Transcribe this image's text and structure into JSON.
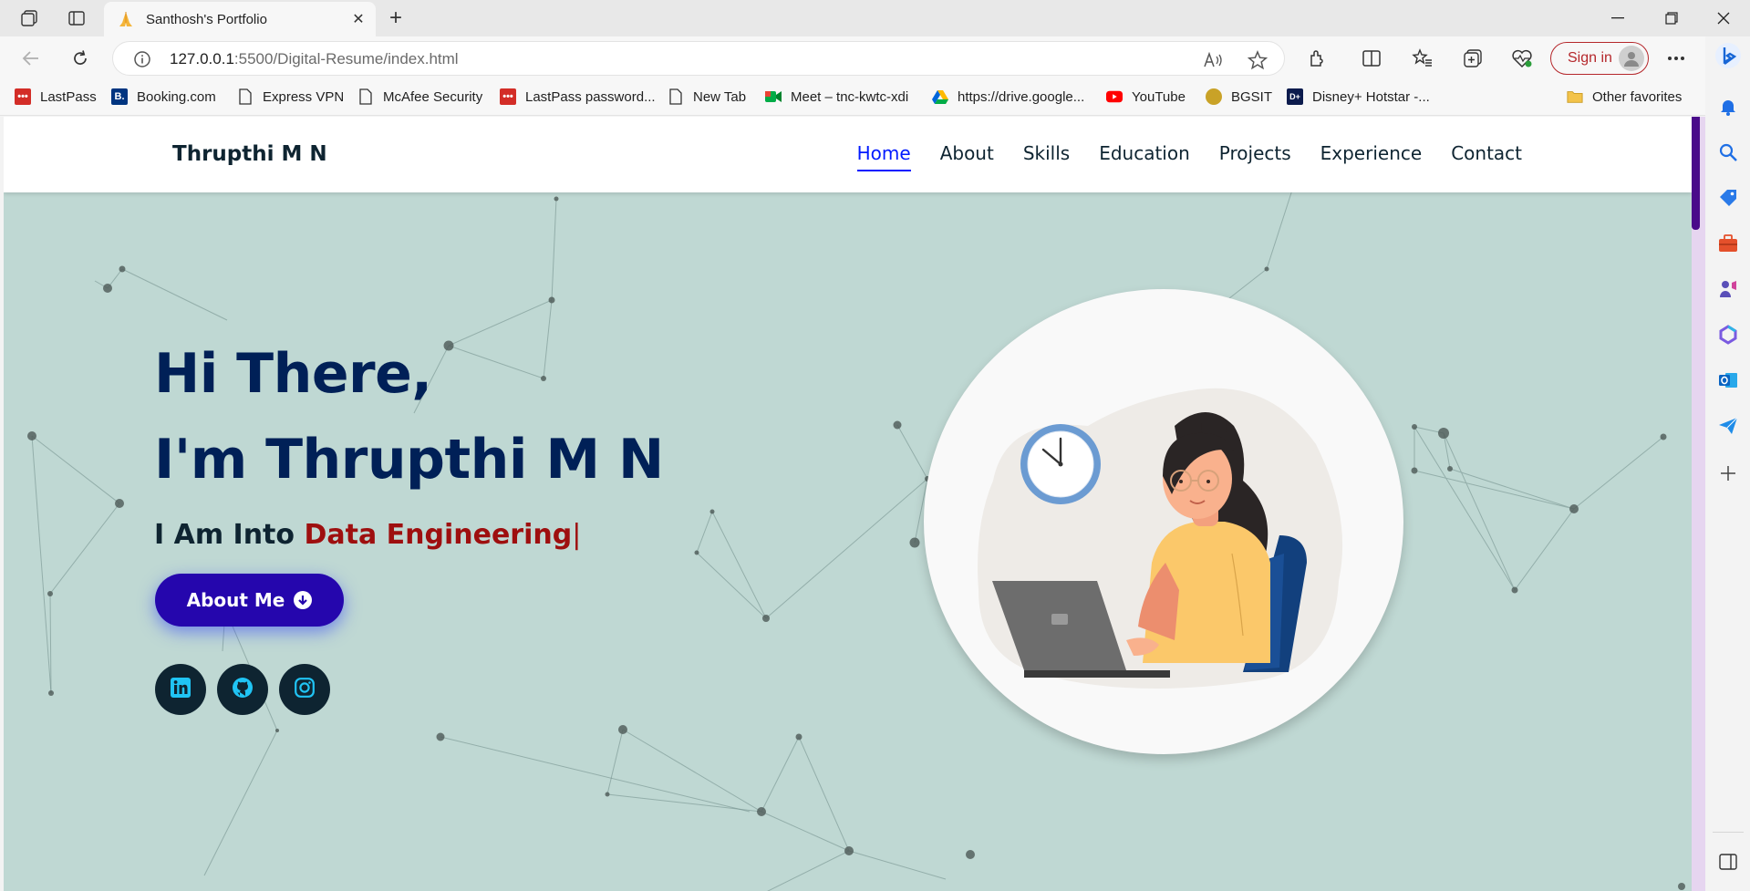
{
  "browser": {
    "tab_title": "Santhosh's Portfolio",
    "url_host": "127.0.0.1",
    "url_path": ":5500/Digital-Resume/index.html",
    "signin_label": "Sign in"
  },
  "favorites": [
    {
      "label": "LastPass",
      "icon": "lastpass-icon"
    },
    {
      "label": "Booking.com",
      "icon": "booking-icon"
    },
    {
      "label": "Express VPN",
      "icon": "page-icon"
    },
    {
      "label": "McAfee Security",
      "icon": "page-icon"
    },
    {
      "label": "LastPass password...",
      "icon": "lastpass-icon"
    },
    {
      "label": "New Tab",
      "icon": "page-icon"
    },
    {
      "label": "Meet – tnc-kwtc-xdi",
      "icon": "meet-icon"
    },
    {
      "label": "https://drive.google...",
      "icon": "drive-icon"
    },
    {
      "label": "YouTube",
      "icon": "youtube-icon"
    },
    {
      "label": "BGSIT",
      "icon": "bgsit-icon"
    },
    {
      "label": "Disney+ Hotstar -...",
      "icon": "hotstar-icon"
    },
    {
      "label": "Other favorites",
      "icon": "folder-icon"
    }
  ],
  "site": {
    "brand": "Thrupthi M N",
    "nav": [
      "Home",
      "About",
      "Skills",
      "Education",
      "Projects",
      "Experience",
      "Contact"
    ],
    "active_nav": "Home",
    "hero": {
      "greeting": "Hi There,",
      "name_line": "I'm Thrupthi M N",
      "typed_prefix": "I Am Into",
      "typed_role": "Data Engineering",
      "cursor": "|",
      "button_label": "About Me"
    },
    "social": [
      "linkedin-icon",
      "github-icon",
      "instagram-icon"
    ]
  },
  "colors": {
    "background": "#bfd8d3",
    "heading": "#002057",
    "role": "#9e0f0f",
    "button": "#2506ad",
    "nav_active": "#011aff"
  }
}
